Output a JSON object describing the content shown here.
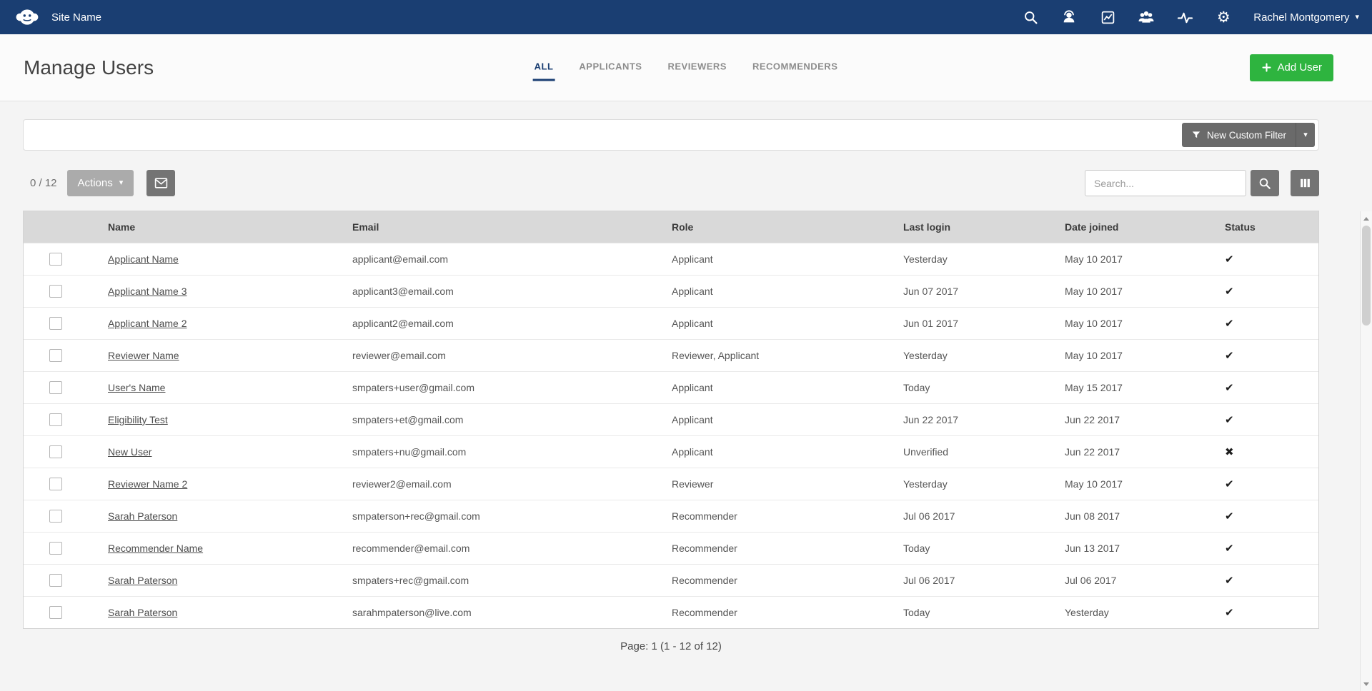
{
  "colors": {
    "topbar_navy": "#1a3e72",
    "accent_green": "#2eb43f",
    "button_gray": "#747474",
    "table_header_gray": "#d9d9d9"
  },
  "icons": {
    "caret_down": "▾",
    "gear": "⚙"
  },
  "topbar": {
    "site_name": "Site Name",
    "user_name": "Rachel Montgomery"
  },
  "header": {
    "title": "Manage Users",
    "tabs": [
      {
        "label": "ALL",
        "active": true
      },
      {
        "label": "APPLICANTS",
        "active": false
      },
      {
        "label": "REVIEWERS",
        "active": false
      },
      {
        "label": "RECOMMENDERS",
        "active": false
      }
    ],
    "add_user_label": "Add User"
  },
  "filter": {
    "new_custom_filter_label": "New Custom Filter"
  },
  "toolbar": {
    "selection_count": "0 / 12",
    "actions_label": "Actions",
    "search_placeholder": "Search..."
  },
  "table": {
    "columns": [
      "Name",
      "Email",
      "Role",
      "Last login",
      "Date joined",
      "Status"
    ],
    "rows": [
      {
        "name": "Applicant Name",
        "email": "applicant@email.com",
        "role": "Applicant",
        "last_login": "Yesterday",
        "date_joined": "May 10 2017",
        "status": "✔"
      },
      {
        "name": "Applicant Name 3",
        "email": "applicant3@email.com",
        "role": "Applicant",
        "last_login": "Jun 07 2017",
        "date_joined": "May 10 2017",
        "status": "✔"
      },
      {
        "name": "Applicant Name 2",
        "email": "applicant2@email.com",
        "role": "Applicant",
        "last_login": "Jun 01 2017",
        "date_joined": "May 10 2017",
        "status": "✔"
      },
      {
        "name": "Reviewer Name",
        "email": "reviewer@email.com",
        "role": "Reviewer, Applicant",
        "last_login": "Yesterday",
        "date_joined": "May 10 2017",
        "status": "✔"
      },
      {
        "name": "User's Name",
        "email": "smpaters+user@gmail.com",
        "role": "Applicant",
        "last_login": "Today",
        "date_joined": "May 15 2017",
        "status": "✔"
      },
      {
        "name": "Eligibility Test",
        "email": "smpaters+et@gmail.com",
        "role": "Applicant",
        "last_login": "Jun 22 2017",
        "date_joined": "Jun 22 2017",
        "status": "✔"
      },
      {
        "name": "New User",
        "email": "smpaters+nu@gmail.com",
        "role": "Applicant",
        "last_login": "Unverified",
        "date_joined": "Jun 22 2017",
        "status": "✖"
      },
      {
        "name": "Reviewer Name 2",
        "email": "reviewer2@email.com",
        "role": "Reviewer",
        "last_login": "Yesterday",
        "date_joined": "May 10 2017",
        "status": "✔"
      },
      {
        "name": "Sarah Paterson",
        "email": "smpaterson+rec@gmail.com",
        "role": "Recommender",
        "last_login": "Jul 06 2017",
        "date_joined": "Jun 08 2017",
        "status": "✔"
      },
      {
        "name": "Recommender Name",
        "email": "recommender@email.com",
        "role": "Recommender",
        "last_login": "Today",
        "date_joined": "Jun 13 2017",
        "status": "✔"
      },
      {
        "name": "Sarah Paterson",
        "email": "smpaters+rec@gmail.com",
        "role": "Recommender",
        "last_login": "Jul 06 2017",
        "date_joined": "Jul 06 2017",
        "status": "✔"
      },
      {
        "name": "Sarah Paterson",
        "email": "sarahmpaterson@live.com",
        "role": "Recommender",
        "last_login": "Today",
        "date_joined": "Yesterday",
        "status": "✔"
      }
    ]
  },
  "pagination": {
    "text": "Page: 1  (1 - 12 of 12)"
  }
}
